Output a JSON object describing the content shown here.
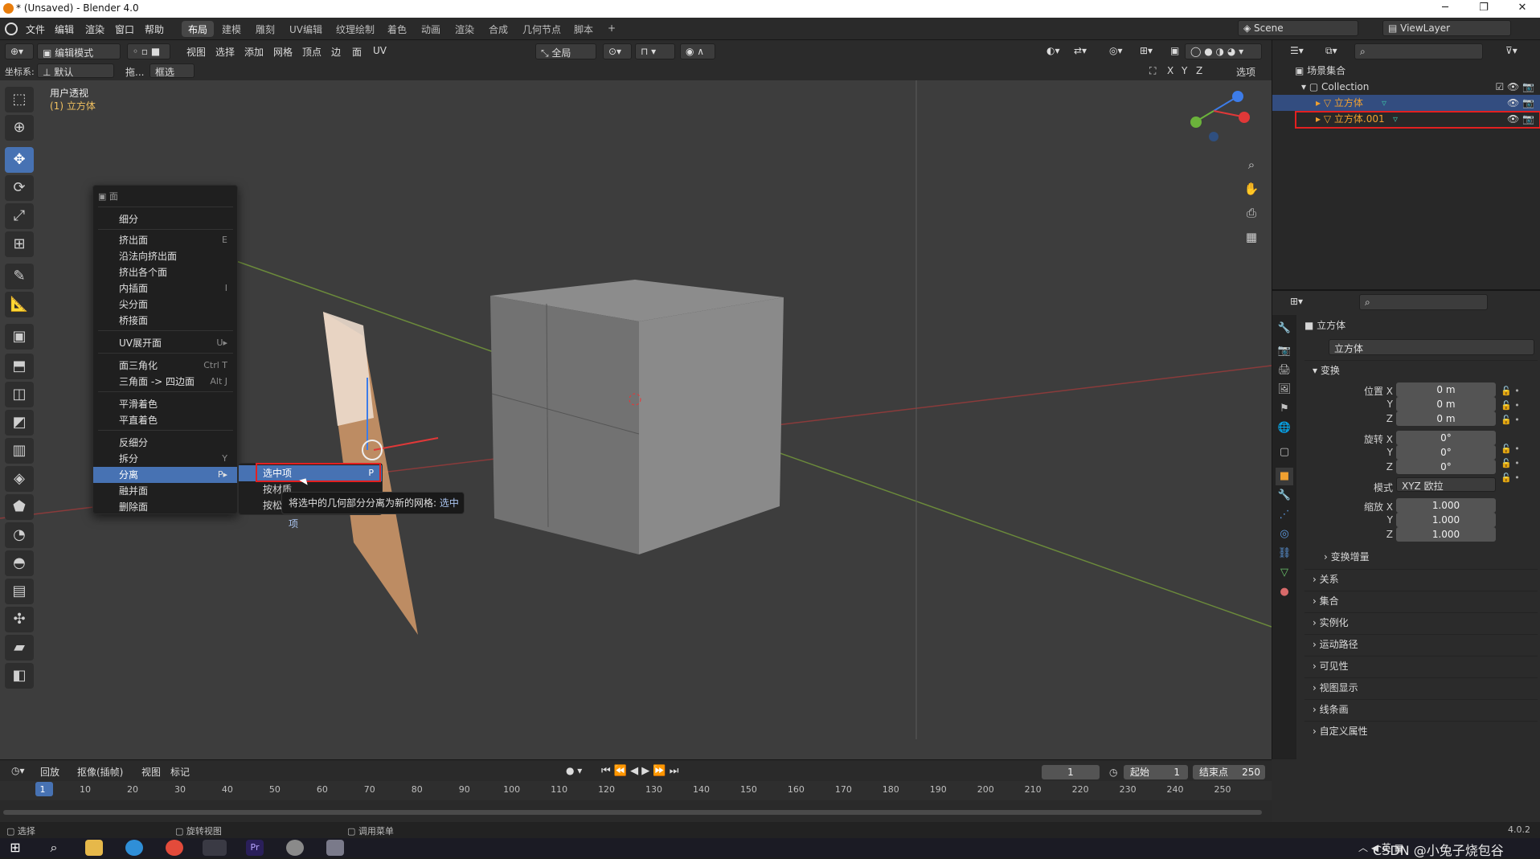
{
  "window": {
    "title": "* (Unsaved) - Blender 4.0",
    "min": "─",
    "max": "❐",
    "close": "✕"
  },
  "menubar": [
    "文件",
    "编辑",
    "渲染",
    "窗口",
    "帮助"
  ],
  "workspaces": [
    "布局",
    "建模",
    "雕刻",
    "UV编辑",
    "纹理绘制",
    "着色",
    "动画",
    "渲染",
    "合成",
    "几何节点",
    "脚本",
    "+"
  ],
  "scene": {
    "label": "Scene",
    "viewlayer": "ViewLayer"
  },
  "vp_header": {
    "mode": "编辑模式",
    "menus": [
      "视图",
      "选择",
      "添加",
      "网格",
      "顶点",
      "边",
      "面",
      "UV"
    ],
    "orient": "全局",
    "options": "选项"
  },
  "vp_header2": {
    "coord_label": "坐标系:",
    "coord_value": "默认",
    "drag": "拖...",
    "select": "框选",
    "axes": [
      "X",
      "Y",
      "Z"
    ]
  },
  "viewport": {
    "view_name": "用户透视",
    "object": "(1) 立方体"
  },
  "context_menu": {
    "title": "面",
    "items": [
      {
        "label": "细分",
        "shortcut": ""
      },
      {
        "label": "挤出面",
        "shortcut": "E"
      },
      {
        "label": "沿法向挤出面",
        "shortcut": ""
      },
      {
        "label": "挤出各个面",
        "shortcut": ""
      },
      {
        "label": "内插面",
        "shortcut": "I"
      },
      {
        "label": "尖分面",
        "shortcut": ""
      },
      {
        "label": "桥接面",
        "shortcut": ""
      },
      {
        "label": "UV展开面",
        "shortcut": "U▸"
      },
      {
        "label": "面三角化",
        "shortcut": "Ctrl T"
      },
      {
        "label": "三角面 -> 四边面",
        "shortcut": "Alt J"
      },
      {
        "label": "平滑着色",
        "shortcut": ""
      },
      {
        "label": "平直着色",
        "shortcut": ""
      },
      {
        "label": "反细分",
        "shortcut": ""
      },
      {
        "label": "拆分",
        "shortcut": "Y"
      },
      {
        "label": "分离",
        "shortcut": "P▸"
      },
      {
        "label": "融并面",
        "shortcut": ""
      },
      {
        "label": "删除面",
        "shortcut": ""
      }
    ]
  },
  "submenu": {
    "items": [
      {
        "label": "选中项",
        "shortcut": "P"
      },
      {
        "label": "按材质",
        "shortcut": ""
      },
      {
        "label": "按松",
        "shortcut": ""
      }
    ]
  },
  "tooltip": {
    "text": "将选中的几何部分分离为新的网格:",
    "value": "选中项"
  },
  "outliner": {
    "scene_collection": "场景集合",
    "collection": "Collection",
    "objects": [
      "立方体",
      "立方体.001"
    ]
  },
  "properties": {
    "object_name": "立方体",
    "data_name": "立方体",
    "section": "变换",
    "location": {
      "label": "位置 X",
      "y": "Y",
      "z": "Z",
      "values": [
        "0 m",
        "0 m",
        "0 m"
      ]
    },
    "rotation": {
      "label": "旋转 X",
      "y": "Y",
      "z": "Z",
      "values": [
        "0°",
        "0°",
        "0°"
      ]
    },
    "mode_label": "模式",
    "mode_value": "XYZ 欧拉",
    "scale": {
      "label": "缩放 X",
      "y": "Y",
      "z": "Z",
      "values": [
        "1.000",
        "1.000",
        "1.000"
      ]
    },
    "delta": "变换增量",
    "panels": [
      "关系",
      "集合",
      "实例化",
      "运动路径",
      "可见性",
      "视图显示",
      "线条画",
      "自定义属性"
    ]
  },
  "timeline": {
    "playback": "回放",
    "keying": "抠像(插帧)",
    "view": "视图",
    "marker": "标记",
    "current": "1",
    "start_label": "起始",
    "start": "1",
    "end_label": "结束点",
    "end": "250",
    "ticks": [
      "1",
      "10",
      "20",
      "30",
      "40",
      "50",
      "60",
      "70",
      "80",
      "90",
      "100",
      "110",
      "120",
      "130",
      "140",
      "150",
      "160",
      "170",
      "180",
      "190",
      "200",
      "210",
      "220",
      "230",
      "240",
      "250"
    ]
  },
  "statusbar": {
    "select": "选择",
    "rotate": "旋转视图",
    "menu": "调用菜单",
    "version": "4.0.2"
  },
  "taskbar": {
    "watermark": "CSDN @小兔子烧包谷",
    "ime": "英"
  },
  "colors": {
    "accent": "#4772b3",
    "highlight_red": "#e32020",
    "selected_orange": "#f0a030"
  }
}
